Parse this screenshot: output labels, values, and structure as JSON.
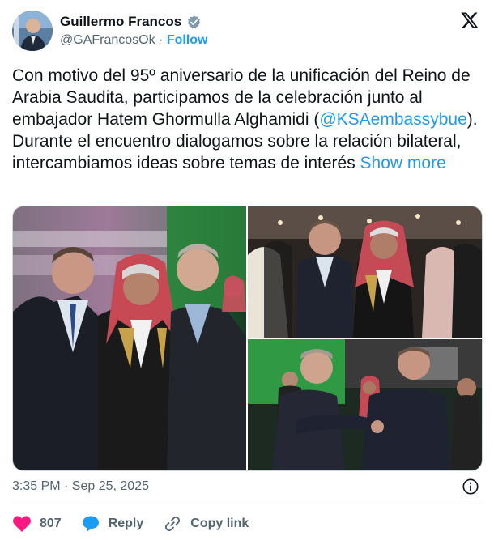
{
  "author": {
    "name": "Guillermo Francos",
    "handle": "@GAFrancosOk",
    "separator": "·",
    "follow_label": "Follow"
  },
  "tweet": {
    "text_before": "Con motivo del 95º aniversario de la unificación del Reino de Arabia Saudita, participamos de la celebración junto al embajador Hatem Ghormulla Alghamidi (",
    "mention": "@KSAembassybue",
    "text_after": "). Durante el encuentro dialogamos sobre la relación bilateral, intercambiamos ideas sobre temas de interés ",
    "show_more": "Show more"
  },
  "meta": {
    "timestamp": "3:35 PM · Sep 25, 2025"
  },
  "actions": {
    "like_count": "807",
    "reply_label": "Reply",
    "copy_link_label": "Copy link"
  },
  "colors": {
    "accent": "#1d9bf0",
    "like": "#f91880",
    "text_secondary": "#536471"
  },
  "icons": [
    "verified-badge-icon",
    "x-logo-icon",
    "info-icon",
    "heart-icon",
    "reply-bubble-icon",
    "link-icon"
  ]
}
